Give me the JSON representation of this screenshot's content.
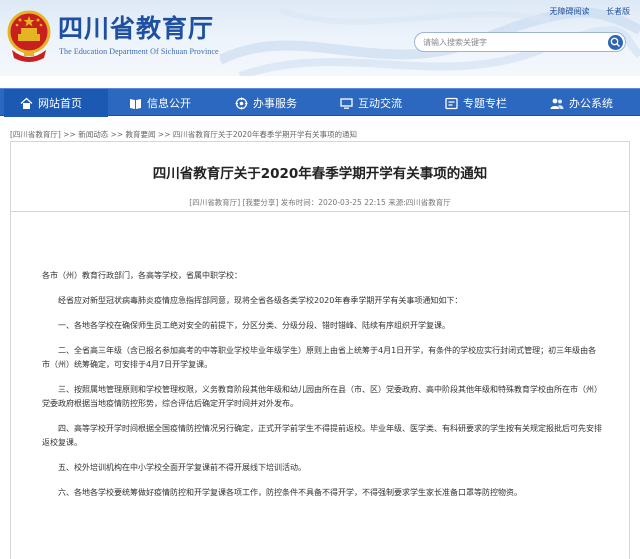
{
  "header": {
    "title": "四川省教育厅",
    "subtitle": "The Education Department Of Sichuan Province",
    "top_links": [
      "无障碍阅读",
      "长者版"
    ],
    "search_placeholder": "请输入搜索关键字"
  },
  "nav": {
    "items": [
      {
        "label": "网站首页",
        "icon": "home-icon",
        "active": true
      },
      {
        "label": "信息公开",
        "icon": "book-icon",
        "active": false
      },
      {
        "label": "办事服务",
        "icon": "service-icon",
        "active": false
      },
      {
        "label": "互动交流",
        "icon": "monitor-icon",
        "active": false
      },
      {
        "label": "专题专栏",
        "icon": "topic-icon",
        "active": false
      },
      {
        "label": "办公系统",
        "icon": "user-group-icon",
        "active": false
      }
    ]
  },
  "breadcrumb": {
    "text": "[四川省教育厅] >> 新闻动态 >> 教育要闻 >> 四川省教育厅关于2020年春季学期开学有关事项的通知"
  },
  "article": {
    "title": "四川省教育厅关于2020年春季学期开学有关事项的通知",
    "meta": "[四川省教育厅]   [我要分享]    发布时间：2020-03-25 22:15   来源:四川省教育厅",
    "paragraphs": [
      {
        "text": "各市（州）教育行政部门，各高等学校，省属中职学校：",
        "indent": false
      },
      {
        "text": "经省应对新型冠状病毒肺炎疫情应急指挥部同意，现将全省各级各类学校2020年春季学期开学有关事项通知如下：",
        "indent": true
      },
      {
        "text": "一、各地各学校在确保师生员工绝对安全的前提下，分区分类、分级分段、错时错峰、陆续有序组织开学复课。",
        "indent": true
      },
      {
        "text": "二、全省高三年级（含已报名参加高考的中等职业学校毕业年级学生）原则上由省上统筹于4月1日开学，有条件的学校应实行封闭式管理；初三年级由各市（州）统筹确定，可安排于4月7日开学复课。",
        "indent": true
      },
      {
        "text": "三、按照属地管理原则和学校管理权限，义务教育阶段其他年级和幼儿园由所在县（市、区）党委政府、高中阶段其他年级和特殊教育学校由所在市（州）党委政府根据当地疫情防控形势，综合评估后确定开学时间并对外发布。",
        "indent": true
      },
      {
        "text": "四、高等学校开学时间根据全国疫情防控情况另行确定，正式开学前学生不得提前返校。毕业年级、医学类、有科研要求的学生按有关规定报批后可先安排返校复课。",
        "indent": true
      },
      {
        "text": "五、校外培训机构在中小学校全面开学复课前不得开展线下培训活动。",
        "indent": true
      },
      {
        "text": "六、各地各学校要统筹做好疫情防控和开学复课各项工作，防控条件不具备不得开学，不得强制要求学生家长准备口罩等防控物资。",
        "indent": true
      }
    ]
  },
  "colors": {
    "nav_bg": "#2c68bf",
    "nav_active": "#1c59b3",
    "title_blue": "#1e4fa0",
    "emblem_red": "#c8201e",
    "emblem_gold": "#e6b422"
  }
}
